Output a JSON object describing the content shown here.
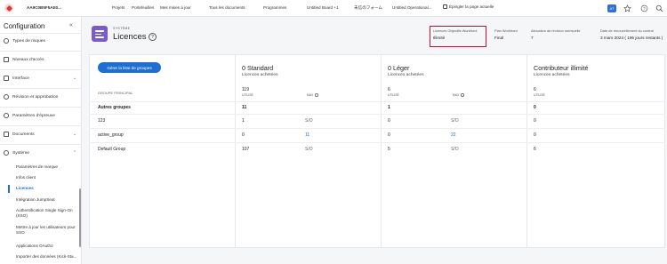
{
  "topbar": {
    "org_name": "AA9C0B5F5AE0... ",
    "nav": [
      "Projets",
      "Portefeuilles",
      "Mes mises à jour",
      "Tous les documents",
      "Programmes",
      "Untitled Board +1",
      "未信のフォーム",
      "Untitled Operational..."
    ],
    "pin_label": "Épingler la page actuelle",
    "badge": "AT"
  },
  "sidebar": {
    "title": "Configuration",
    "items": [
      {
        "label": "Types de risques",
        "icon": "risk-icon"
      },
      {
        "label": "Niveaux d'accès",
        "icon": "lock-icon"
      },
      {
        "label": "Interface",
        "icon": "interface-icon"
      },
      {
        "label": "Révision et approbation",
        "icon": "review-icon"
      },
      {
        "label": "Paramètres d'épreuve",
        "icon": "proof-icon"
      },
      {
        "label": "Documents",
        "icon": "document-icon"
      },
      {
        "label": "Système",
        "icon": "system-icon"
      }
    ],
    "sub_items": [
      "Paramètres de marque",
      "Infos client",
      "Licences",
      "Intégration JumpSeat",
      "Authentification Single Sign-On (SSO)",
      "Mettre à jour les utilisateurs pour SSO",
      "Applications OAuth2",
      "Importer des données (Kick-Sta..."
    ],
    "active_sub": "Licences"
  },
  "header": {
    "kicker": "SYSTÈME",
    "title": "Licences",
    "help": "?"
  },
  "meta": [
    {
      "key": "Licences Objectifs Workfront",
      "value": "Illimité"
    },
    {
      "key": "Plan Workfront",
      "value": "Final"
    },
    {
      "key": "Allocation de révision mensuelle",
      "value": "7"
    },
    {
      "key": "Date de renouvellement du contrat",
      "value": "3 mars 2024 ( 195 jours restants )"
    }
  ],
  "table": {
    "manage_button": "Gérer la liste de groupes",
    "group_col_header": "GROUPE PRINCIPAL",
    "columns": [
      {
        "title": "0 Standard",
        "subtitle": "Licences achetées",
        "used_total": "119",
        "used_label": "UTILISÉ",
        "max_label": "MAX"
      },
      {
        "title": "0 Léger",
        "subtitle": "Licences achetées",
        "used_total": "6",
        "used_label": "UTILISÉ",
        "max_label": "MAX"
      },
      {
        "title": "Contributeur illimité",
        "subtitle": "Licences achetées",
        "used_total": "6",
        "used_label": "UTILISÉ",
        "max_label": ""
      }
    ],
    "rows": [
      {
        "group": "Autres groupes",
        "std_used": "11",
        "std_max": "",
        "light_used": "1",
        "light_max": "",
        "contrib": "0"
      },
      {
        "group": "123",
        "std_used": "1",
        "std_max": "S/O",
        "light_used": "0",
        "light_max": "S/O",
        "contrib": "0"
      },
      {
        "group": "active_group",
        "std_used": "0",
        "std_max": "11",
        "light_used": "0",
        "light_max": "22",
        "contrib": "0"
      },
      {
        "group": "Default Group",
        "std_used": "107",
        "std_max": "S/O",
        "light_used": "5",
        "light_max": "S/O",
        "contrib": "6"
      }
    ]
  },
  "colors": {
    "accent": "#1f6fd1",
    "highlight": "#c8102e",
    "header_icon": "#7b5bc9"
  }
}
